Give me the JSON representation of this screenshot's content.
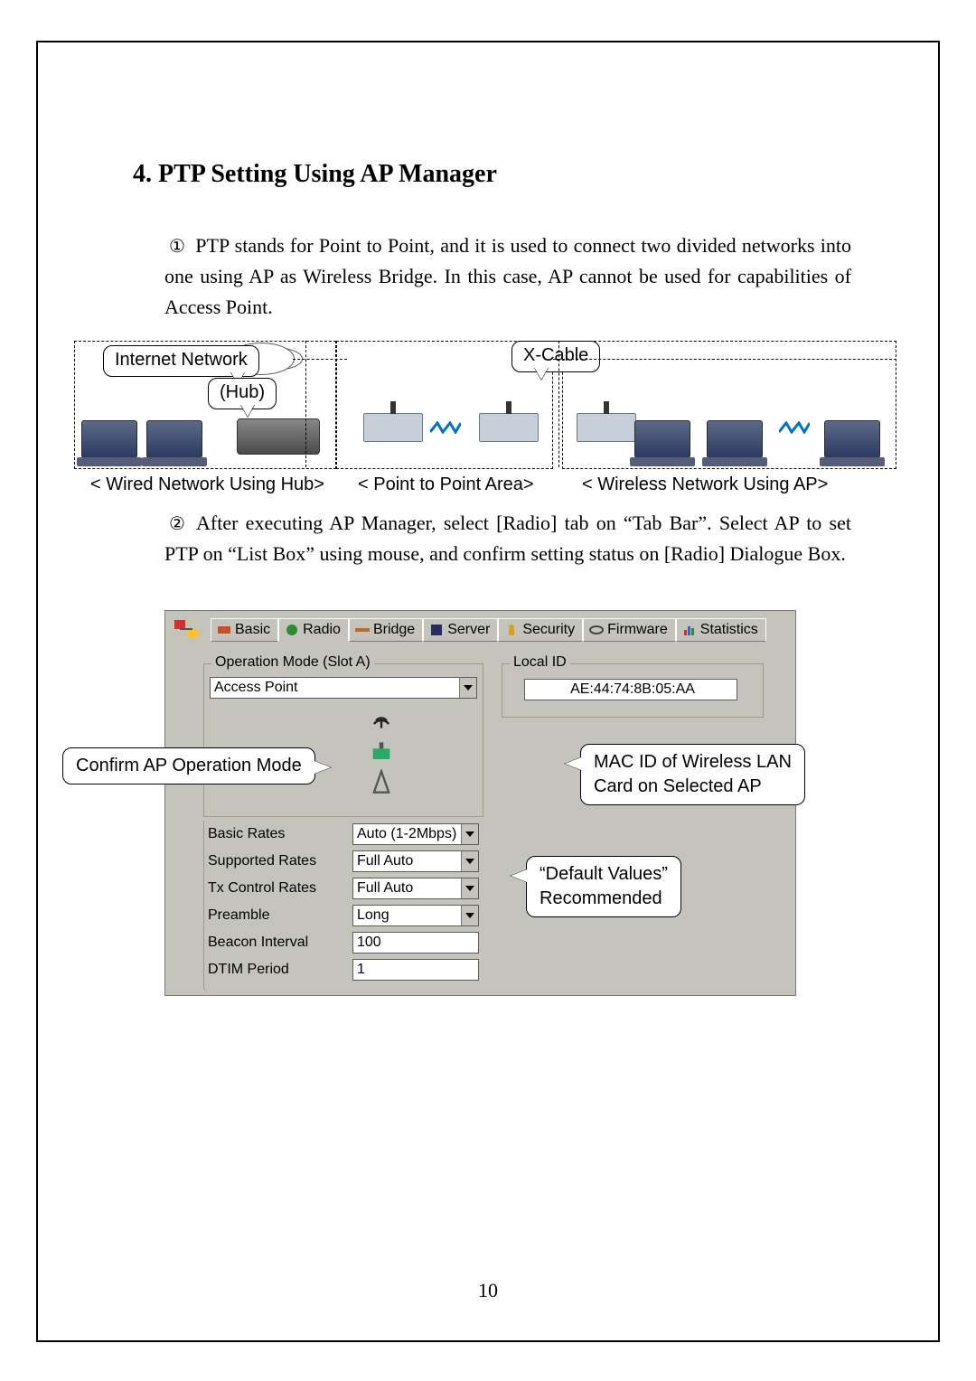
{
  "section_title": "4. PTP Setting Using AP Manager",
  "para1_num": "①",
  "para1_text": "PTP stands for Point to Point, and it is used to connect two divided networks into one using AP as Wireless Bridge. In this case, AP cannot be used for capabilities of Access Point.",
  "diagram": {
    "internet": "Internet Network",
    "hub": "(Hub)",
    "xcable": "X-Cable",
    "zone_a_caption": "< Wired Network Using Hub>",
    "zone_b_caption": "< Point to Point Area>",
    "zone_c_caption": "< Wireless Network Using AP>"
  },
  "para2_num": "②",
  "para2_text": "After executing AP Manager, select [Radio] tab on “Tab Bar”. Select AP to set PTP on “List Box” using mouse, and confirm setting status on [Radio] Dialogue Box.",
  "ui": {
    "tabs": {
      "basic": "Basic",
      "radio": "Radio",
      "bridge": "Bridge",
      "server": "Server",
      "security": "Security",
      "firmware": "Firmware",
      "statistics": "Statistics"
    },
    "opmode": {
      "legend": "Operation Mode (Slot A)",
      "value": "Access Point"
    },
    "localid": {
      "legend": "Local ID",
      "value": "AE:44:74:8B:05:AA"
    },
    "rates": {
      "basic_rates_label": "Basic Rates",
      "basic_rates_value": "Auto (1-2Mbps)",
      "supported_rates_label": "Supported Rates",
      "supported_rates_value": "Full Auto",
      "tx_control_label": "Tx Control Rates",
      "tx_control_value": "Full Auto",
      "preamble_label": "Preamble",
      "preamble_value": "Long",
      "beacon_label": "Beacon Interval",
      "beacon_value": "100",
      "dtim_label": "DTIM Period",
      "dtim_value": "1"
    }
  },
  "callouts": {
    "confirm_opmode": "Confirm AP Operation Mode",
    "mac_id_l1": "MAC ID of Wireless LAN",
    "mac_id_l2": "Card on Selected AP",
    "default_l1": "“Default  Values”",
    "default_l2": "Recommended"
  },
  "page_number": "10"
}
